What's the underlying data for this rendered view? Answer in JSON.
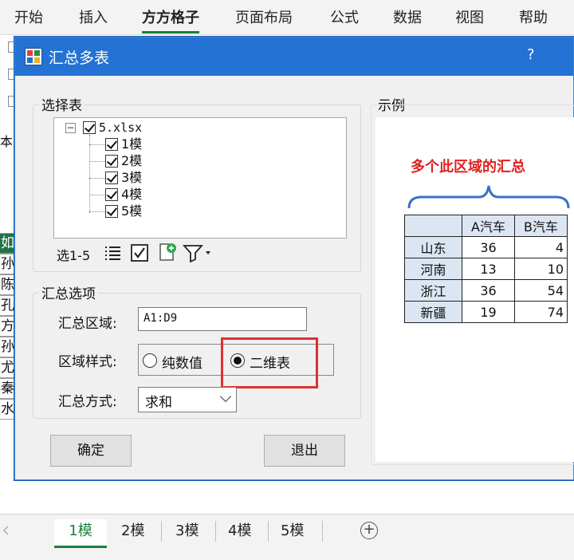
{
  "ribbon": {
    "tabs": [
      {
        "label": "开始"
      },
      {
        "label": "插入"
      },
      {
        "label": "方方格子"
      },
      {
        "label": "页面布局"
      },
      {
        "label": "公式"
      },
      {
        "label": "数据"
      },
      {
        "label": "视图"
      },
      {
        "label": "帮助"
      }
    ],
    "active_tab": "方方格子"
  },
  "sheet_peek": {
    "text_ben": "本",
    "rows": [
      "如",
      "孙",
      "陈",
      "孔",
      "方",
      "孙",
      "尤",
      "秦",
      "水"
    ]
  },
  "dialog": {
    "title": "汇总多表",
    "help": "?",
    "select_group_label": "选择表",
    "tree": {
      "root": "5.xlsx",
      "children": [
        "1模",
        "2模",
        "3模",
        "4模",
        "5模"
      ]
    },
    "toolbar": {
      "select_range": "选1-5"
    },
    "options_group_label": "汇总选项",
    "range_label": "汇总区域:",
    "range_value": "A1:D9",
    "style_label": "区域样式:",
    "style_option_plain": "纯数值",
    "style_option_2d": "二维表",
    "style_selected": "二维表",
    "method_label": "汇总方式:",
    "method_value": "求和",
    "ok_label": "确定",
    "exit_label": "退出"
  },
  "example": {
    "label": "示例",
    "title": "多个此区域的汇总",
    "table": {
      "headers": [
        "",
        "A汽车",
        "B汽车"
      ],
      "rows": [
        {
          "name": "山东",
          "a": "36",
          "b": "4"
        },
        {
          "name": "河南",
          "a": "13",
          "b": "10"
        },
        {
          "name": "浙江",
          "a": "36",
          "b": "54"
        },
        {
          "name": "新疆",
          "a": "19",
          "b": "74"
        }
      ]
    }
  },
  "sheet_tabs": {
    "tabs": [
      "1模",
      "2模",
      "3模",
      "4模",
      "5模"
    ],
    "active": "1模",
    "add": "+"
  },
  "colors": {
    "title_bar": "#2472d3",
    "accent_green": "#1a7f3c",
    "highlight_red": "#e03030",
    "example_title": "#e02020",
    "table_header": "#dce6f2"
  }
}
